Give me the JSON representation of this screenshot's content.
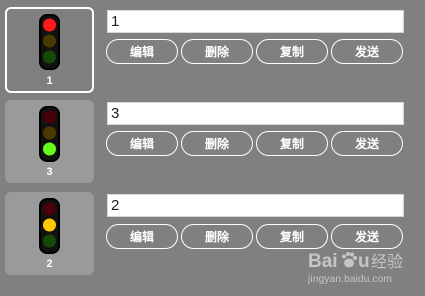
{
  "rows": [
    {
      "number": "1",
      "input_value": "1",
      "active_light": "red",
      "selected": true
    },
    {
      "number": "3",
      "input_value": "3",
      "active_light": "green",
      "selected": false
    },
    {
      "number": "2",
      "input_value": "2",
      "active_light": "yellow",
      "selected": false
    }
  ],
  "buttons": {
    "edit": "编辑",
    "delete": "删除",
    "copy": "复制",
    "send": "发送"
  },
  "watermark": {
    "brand_text": "Baidu经验",
    "url": "jingyan.baidu.com"
  },
  "colors": {
    "background": "#808080",
    "card": "#9a9a9a",
    "red_on": "#ff1a1a",
    "yellow_on": "#ffc800",
    "green_on": "#66ff1a",
    "red_off": "#4a0008",
    "yellow_off": "#4a3a00",
    "green_off": "#154a05"
  },
  "icons": {
    "traffic_light": "traffic-light-icon",
    "watermark": "baidu-paw-icon"
  }
}
